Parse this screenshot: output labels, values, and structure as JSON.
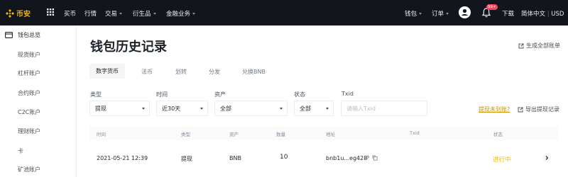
{
  "topbar": {
    "brand": "币安",
    "nav_left": [
      {
        "label": "买币",
        "has_caret": false
      },
      {
        "label": "行情",
        "has_caret": false
      },
      {
        "label": "交易",
        "has_caret": true
      },
      {
        "label": "衍生品",
        "has_caret": true
      },
      {
        "label": "金融业务",
        "has_caret": true
      }
    ],
    "wallet": "钱包",
    "orders": "订单",
    "notification_badge": "99+",
    "download": "下载",
    "language": "简体中文",
    "separator": "|",
    "currency": "USD"
  },
  "sidebar": {
    "items": [
      {
        "label": "钱包总览"
      },
      {
        "label": "现货账户"
      },
      {
        "label": "杠杆账户"
      },
      {
        "label": "合约账户"
      },
      {
        "label": "C2C账户"
      },
      {
        "label": "理财账户"
      },
      {
        "label": "卡"
      },
      {
        "label": "矿池账户"
      }
    ]
  },
  "main": {
    "title": "钱包历史记录",
    "statement_link": "生成全部账单",
    "tabs": [
      "数字货币",
      "法币",
      "划转",
      "分发",
      "兑换BNB"
    ],
    "filters": {
      "type_label": "类型",
      "type_value": "提现",
      "time_label": "时间",
      "time_value": "近30天",
      "asset_label": "资产",
      "asset_value": "全部",
      "status_label": "状态",
      "status_value": "全部",
      "txid_label": "Txid",
      "txid_placeholder": "请输入Txid"
    },
    "not_arrived_link": "提现未到账?",
    "export_link": "导出提现记录",
    "table": {
      "columns": [
        "时间",
        "类型",
        "资产",
        "数量",
        "地址",
        "Txid",
        "状态"
      ],
      "rows": [
        {
          "time": "2021-05-21 12:39",
          "type": "提现",
          "asset": "BNB",
          "quantity": "10",
          "address": "bnb1u...eg428",
          "txid": "",
          "status": "进行中"
        }
      ]
    }
  },
  "colors": {
    "brand": "#f0b90b",
    "topbar_bg": "#12161c",
    "link": "#c99400",
    "status_pending": "#f0b90b"
  }
}
